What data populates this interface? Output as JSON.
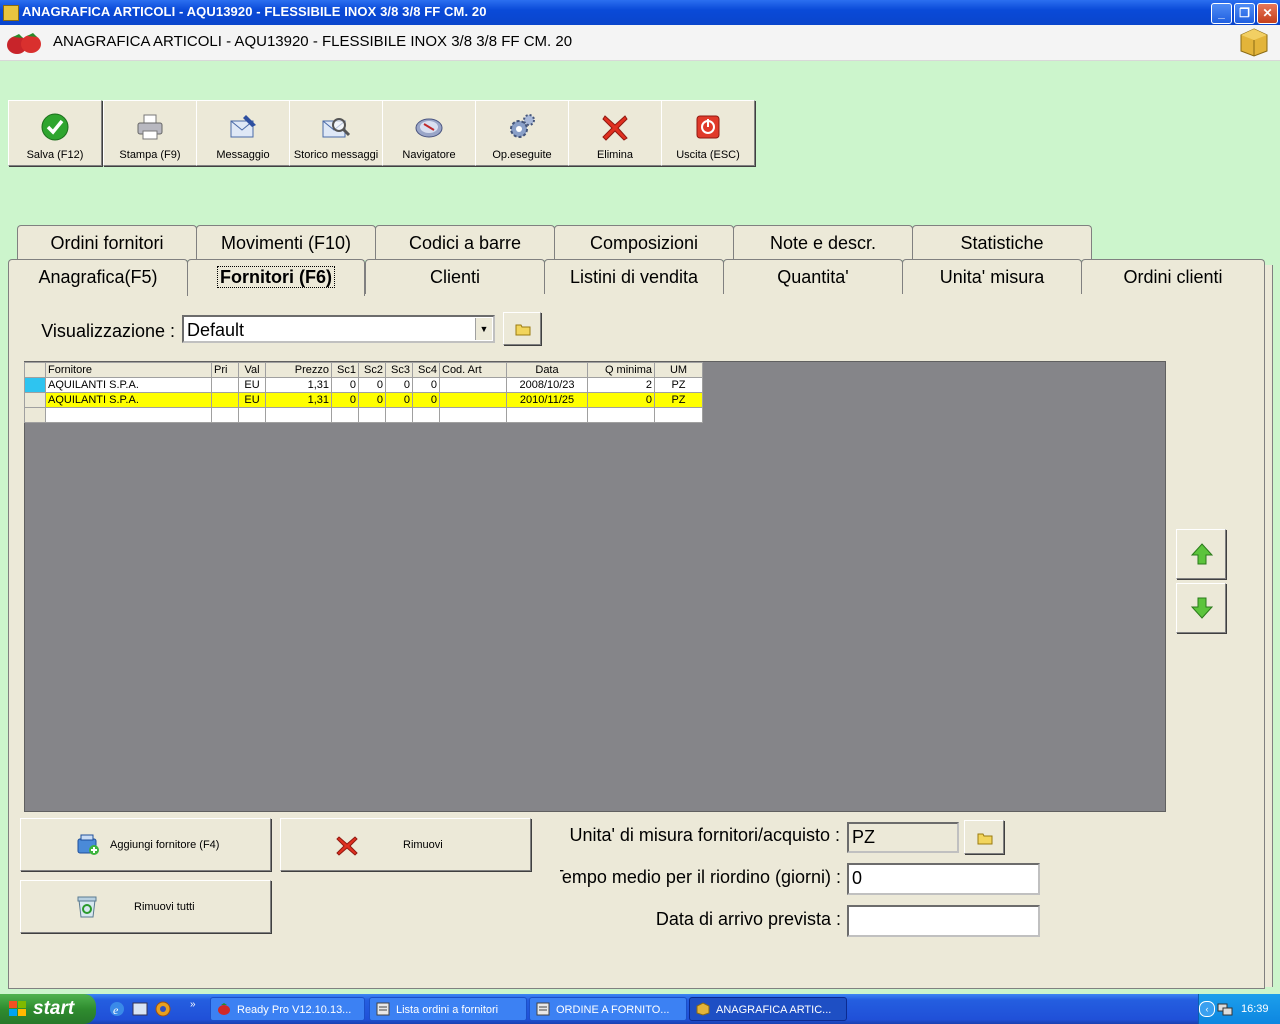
{
  "window": {
    "title": "ANAGRAFICA ARTICOLI - AQU13920 - FLESSIBILE INOX 3/8 3/8 FF CM. 20",
    "header_title": "ANAGRAFICA ARTICOLI - AQU13920 - FLESSIBILE INOX 3/8 3/8 FF CM. 20"
  },
  "toolbar": [
    {
      "label": "Salva (F12)",
      "icon": "check-icon"
    },
    {
      "label": "Stampa (F9)",
      "icon": "printer-icon"
    },
    {
      "label": "Messaggio",
      "icon": "envelope-pen-icon"
    },
    {
      "label": "Storico messaggi",
      "icon": "envelope-search-icon"
    },
    {
      "label": "Navigatore",
      "icon": "navigator-icon"
    },
    {
      "label": "Op.eseguite",
      "icon": "gears-icon"
    },
    {
      "label": "Elimina",
      "icon": "red-x-icon"
    },
    {
      "label": "Uscita (ESC)",
      "icon": "power-icon"
    }
  ],
  "tabs_row1": [
    "Ordini fornitori",
    "Movimenti (F10)",
    "Codici a barre",
    "Composizioni",
    "Note e descr.",
    "Statistiche"
  ],
  "tabs_row2": [
    "Anagrafica(F5)",
    "Fornitori (F6)",
    "Clienti",
    "Listini di vendita",
    "Quantita'",
    "Unita' misura",
    "Ordini clienti"
  ],
  "active_tab": "Fornitori (F6)",
  "visualizzazione": {
    "label": "Visualizzazione :",
    "value": "Default"
  },
  "grid": {
    "columns": [
      "Fornitore",
      "Pri",
      "Val",
      "Prezzo",
      "Sc1",
      "Sc2",
      "Sc3",
      "Sc4",
      "Cod. Art",
      "Data",
      "Q minima",
      "UM"
    ],
    "rows": [
      [
        "AQUILANTI S.P.A.",
        "",
        "EU",
        "1,31",
        "0",
        "0",
        "0",
        "0",
        "",
        "2008/10/23",
        "2",
        "PZ"
      ],
      [
        "AQUILANTI S.P.A.",
        "",
        "EU",
        "1,31",
        "0",
        "0",
        "0",
        "0",
        "",
        "2010/11/25",
        "0",
        "PZ"
      ]
    ]
  },
  "buttons": {
    "add_supplier": "Aggiungi fornitore (F4)",
    "remove": "Rimuovi",
    "remove_all": "Rimuovi tutti"
  },
  "form": {
    "um_label": "Unita' di misura fornitori/acquisto :",
    "um_value": "PZ",
    "tempo_label": "Tempo medio per il riordino (giorni) :",
    "tempo_value": "0",
    "data_label": "Data di arrivo prevista :",
    "data_value": ""
  },
  "taskbar": {
    "start": "start",
    "tasks": [
      "Ready Pro V12.10.13...",
      "Lista ordini a fornitori",
      "ORDINE A FORNITO...",
      "ANAGRAFICA ARTIC..."
    ],
    "clock": "16:39"
  },
  "colors": {
    "selected_row": "#ffff00",
    "grid_bg": "#858589",
    "desktop_bg": "#ccf5cc"
  }
}
